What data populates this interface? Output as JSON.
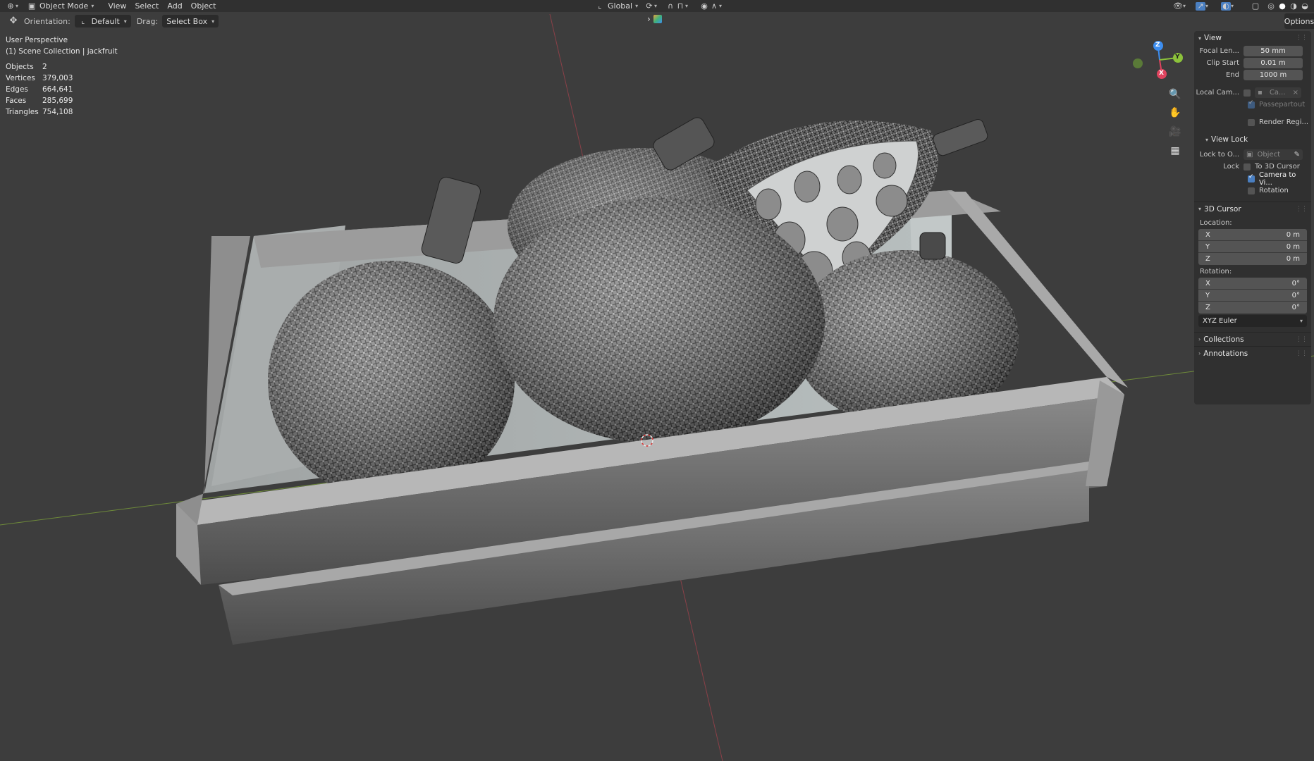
{
  "header": {
    "mode_label": "Object Mode",
    "menus": [
      "View",
      "Select",
      "Add",
      "Object"
    ],
    "transform_orientation": "Global"
  },
  "toolbar": {
    "orientation_label": "Orientation:",
    "orientation_value": "Default",
    "drag_label": "Drag:",
    "drag_value": "Select Box",
    "options_label": "Options"
  },
  "overlay": {
    "view_name": "User Perspective",
    "collection": "(1) Scene Collection | jackfruit",
    "stats": [
      {
        "label": "Objects",
        "value": "2"
      },
      {
        "label": "Vertices",
        "value": "379,003"
      },
      {
        "label": "Edges",
        "value": "664,641"
      },
      {
        "label": "Faces",
        "value": "285,699"
      },
      {
        "label": "Triangles",
        "value": "754,108"
      }
    ]
  },
  "gizmo": {
    "x": "X",
    "y": "Y",
    "z": "Z"
  },
  "npanel": {
    "view": {
      "title": "View",
      "focal_label": "Focal Len...",
      "focal_value": "50 mm",
      "clip_start_label": "Clip Start",
      "clip_start_value": "0.01 m",
      "end_label": "End",
      "end_value": "1000 m",
      "local_cam_label": "Local Cam...",
      "local_cam_value": "Ca...",
      "passepartout": "Passepartout",
      "render_region": "Render Regi..."
    },
    "view_lock": {
      "title": "View Lock",
      "lock_to_label": "Lock to O...",
      "lock_to_value": "Object",
      "lock_label": "Lock",
      "to_3d_cursor": "To 3D Cursor",
      "camera_to_view": "Camera to Vi...",
      "rotation": "Rotation"
    },
    "cursor": {
      "title": "3D Cursor",
      "location_label": "Location:",
      "location": [
        {
          "axis": "X",
          "value": "0 m"
        },
        {
          "axis": "Y",
          "value": "0 m"
        },
        {
          "axis": "Z",
          "value": "0 m"
        }
      ],
      "rotation_label": "Rotation:",
      "rotation": [
        {
          "axis": "X",
          "value": "0°"
        },
        {
          "axis": "Y",
          "value": "0°"
        },
        {
          "axis": "Z",
          "value": "0°"
        }
      ],
      "rotation_mode": "XYZ Euler"
    },
    "collections_title": "Collections",
    "annotations_title": "Annotations"
  },
  "colors": {
    "background": "#3d3d3d",
    "header": "#303030",
    "x_axis": "#e0445f",
    "y_axis": "#8cc23b",
    "z_axis": "#3d8ef0",
    "accent": "#4a7fc1"
  }
}
